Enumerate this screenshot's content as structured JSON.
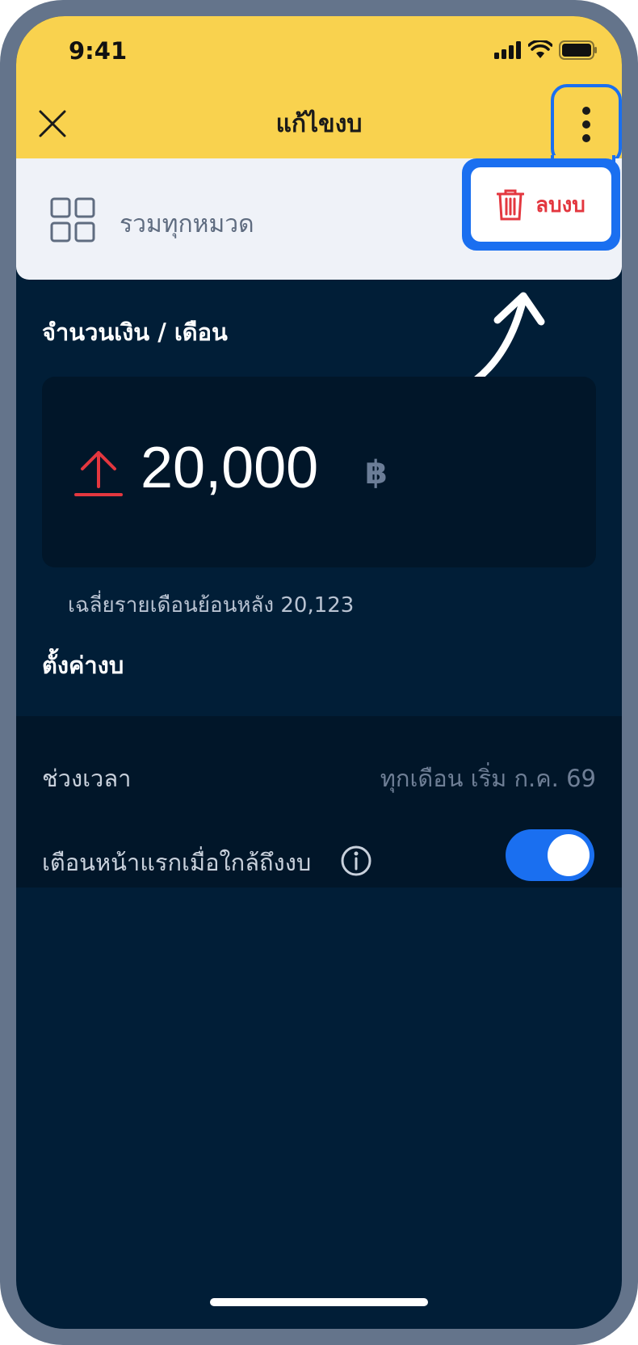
{
  "status_bar": {
    "time": "9:41"
  },
  "header": {
    "title": "แก้ไขงบ"
  },
  "category": {
    "label": "รวมทุกหมวด"
  },
  "menu": {
    "delete_label": "ลบงบ"
  },
  "amount": {
    "section_title": "จำนวนเงิน / เดือน",
    "value": "20,000",
    "currency": "฿",
    "average_text": "เฉลี่ยรายเดือนย้อนหลัง 20,123"
  },
  "settings": {
    "section_title": "ตั้งค่างบ",
    "period_label": "ช่วงเวลา",
    "period_value": "ทุกเดือน เริ่ม ก.ค. 69",
    "notify_label": "เตือนหน้าแรกเมื่อใกล้ถึงงบ",
    "notify_enabled": true
  },
  "colors": {
    "header_bg": "#f9d24e",
    "screen_bg": "#011e37",
    "accent_blue": "#1a6ff0",
    "danger_red": "#e3373f"
  }
}
